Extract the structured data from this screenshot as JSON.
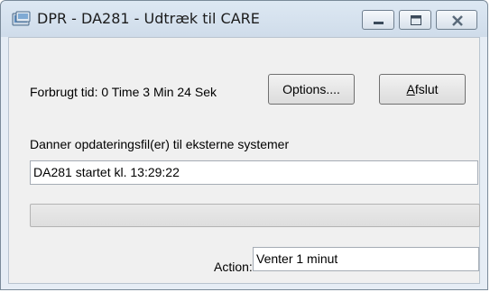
{
  "window": {
    "title": "DPR - DA281 - Udtræk til CARE"
  },
  "icons": {
    "app": "app-window-icon",
    "minimize": "minimize-icon",
    "maximize": "maximize-icon",
    "close": "close-icon"
  },
  "main": {
    "elapsed_label": "Forbrugt tid:  0 Time 3 Min 24 Sek",
    "options_button": "Options....",
    "exit_button_underlined": "A",
    "exit_button_rest": "fslut",
    "description_label": "Danner opdateringsfil(er) til eksterne systemer",
    "status_value": "DA281 startet kl. 13:29:22",
    "progress_fraction": 0,
    "action_label": "Action:",
    "action_value": "Venter 1 minut"
  },
  "colors": {
    "titlebar": "#d5e1ee",
    "client_bg": "#f0f0f0",
    "progress_fill": "#3ab54a"
  }
}
